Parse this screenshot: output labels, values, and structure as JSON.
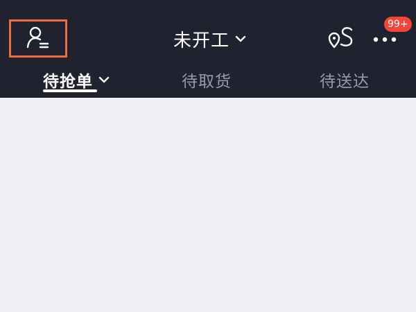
{
  "header": {
    "status_label": "未开工",
    "notification_badge": "99+"
  },
  "tabs": [
    {
      "label": "待抢单",
      "active": true
    },
    {
      "label": "待取货",
      "active": false
    },
    {
      "label": "待送达",
      "active": false
    }
  ],
  "icons": {
    "profile": "user-list-icon",
    "route": "route-pin-icon",
    "more": "more-dots-icon"
  },
  "colors": {
    "header_bg": "#212230",
    "content_bg": "#f0eff4",
    "highlight_border": "#f06a3e",
    "badge_bg": "#f4453c"
  }
}
